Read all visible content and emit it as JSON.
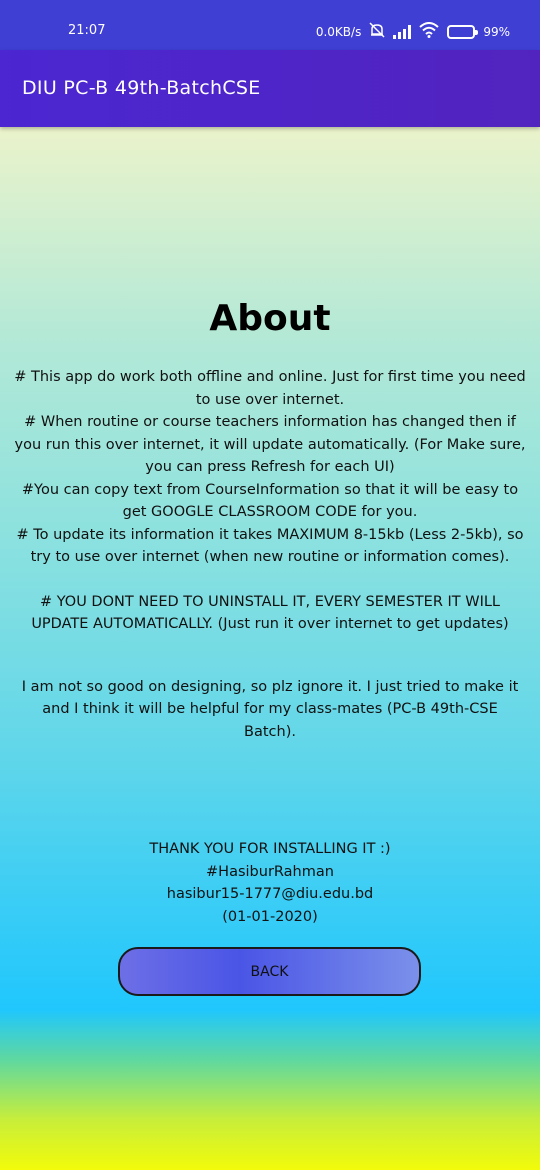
{
  "status_bar": {
    "time": "21:07",
    "net_speed": "0.0KB/s",
    "battery": "99%",
    "icons": [
      "mute-icon",
      "signal-icon",
      "wifi-icon",
      "battery-icon"
    ]
  },
  "app_bar": {
    "title": "DIU PC-B 49th-BatchCSE",
    "color": "#4b26d1"
  },
  "about": {
    "heading": "About",
    "paragraphs": [
      "# This app do work both offline and online. Just for first time you need to use over internet.",
      "# When routine or course teachers information has changed then if you run this over internet, it will update automatically. (For Make sure, you can press Refresh for each UI)",
      "#You can copy text from CourseInformation so that it will be easy to get GOOGLE CLASSROOM CODE for you.",
      "# To update its information it takes MAXIMUM 8-15kb (Less 2-5kb), so try to use over internet (when new routine or information comes).",
      "# YOU DONT NEED TO UNINSTALL IT, EVERY SEMESTER IT WILL UPDATE AUTOMATICALLY. (Just run it over internet to get updates)",
      "I am not so good on designing, so plz ignore it. I just tried to make it and I think it will be helpful for my class-mates (PC-B 49th-CSE Batch)."
    ]
  },
  "thanks": {
    "line1": "THANK YOU FOR INSTALLING IT :)",
    "line2": "#HasiburRahman",
    "line3": "hasibur15-1777@diu.edu.bd",
    "line4": "(01-01-2020)"
  },
  "back_button": {
    "label": "BACK"
  }
}
